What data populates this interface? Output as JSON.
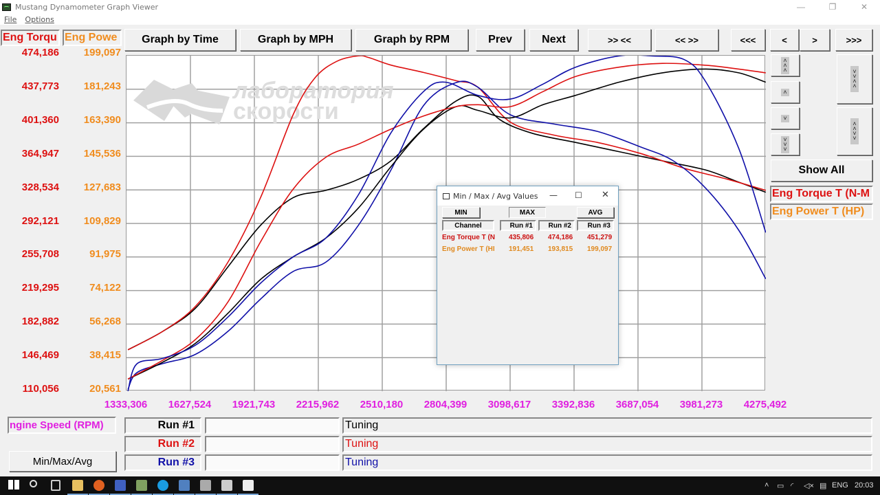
{
  "window": {
    "title": "Mustang Dynamometer Graph Viewer",
    "controls": {
      "minimize": "—",
      "maximize": "❐",
      "close": "✕"
    }
  },
  "menu": {
    "items": [
      {
        "label": "File",
        "accel": "F"
      },
      {
        "label": "Options",
        "accel": "O"
      }
    ]
  },
  "channels": {
    "left_torque_label": "Eng Torqu",
    "left_power_label": "Eng Powe",
    "right_torque_label": "Eng Torque T (N-M",
    "right_power_label": "Eng Power T (HP)",
    "x_channel_label": "ngine Speed (RPM)"
  },
  "toolbar": {
    "graph_by_time": "Graph by Time",
    "graph_by_mph": "Graph by MPH",
    "graph_by_rpm": "Graph by RPM",
    "prev": "Prev",
    "next": "Next",
    "zoom_in": ">> <<",
    "zoom_out": "<< >>",
    "first": "<<<",
    "left": "<",
    "right": ">",
    "last": ">>>"
  },
  "side_controls": {
    "scroll_up_fast": "˄˄˄",
    "scroll_up": "˄",
    "scroll_down": "˅",
    "scroll_down_fast": "˅˅˅",
    "expand": "˅˅˄˄",
    "compress": "˄˄˅˅",
    "show_all": "Show All"
  },
  "runs": [
    {
      "label": "Run #1",
      "name": "",
      "desc": "Tuning",
      "color": "#000000"
    },
    {
      "label": "Run #2",
      "name": "",
      "desc": "Tuning",
      "color": "#dd1111"
    },
    {
      "label": "Run #3",
      "name": "",
      "desc": "Tuning",
      "color": "#1010a8"
    }
  ],
  "minmax_button": "Min/Max/Avg",
  "watermark": {
    "line1": "лаборатория",
    "line2": "скорости"
  },
  "dialog": {
    "title": "Min / Max / Avg Values",
    "min_btn": "MIN",
    "max_btn": "MAX",
    "avg_btn": "AVG",
    "headers": [
      "Channel",
      "Run #1",
      "Run #2",
      "Run #3"
    ],
    "rows": [
      {
        "channel": "Eng Torque T (N",
        "values": [
          "435,806",
          "474,186",
          "451,279"
        ],
        "color": "#cc1111"
      },
      {
        "channel": "Eng Power T (HI",
        "values": [
          "191,451",
          "193,815",
          "199,097"
        ],
        "color": "#e08a20"
      }
    ]
  },
  "colors": {
    "torque": "#dd1111",
    "power": "#f08c1e",
    "rpm": "#e020e0"
  },
  "taskbar": {
    "language": "ENG",
    "time": "20:03",
    "apps": [
      "start",
      "search",
      "task-view",
      "file-explorer",
      "firefox",
      "save-app",
      "paint-app",
      "skype",
      "network-app",
      "dyno-viewer",
      "tuning-app",
      "photos"
    ]
  },
  "chart_data": {
    "type": "line",
    "title": "",
    "xlabel": "Engine Speed (RPM)",
    "ylabel_left": "Eng Torque T (N-M)",
    "ylabel_right": "Eng Power T (HP)",
    "xlim": [
      1333.306,
      4275.492
    ],
    "ylim_torque": [
      110.056,
      474.186
    ],
    "ylim_power": [
      20.561,
      199.097
    ],
    "x_ticks": [
      "1333,306",
      "1627,524",
      "1921,743",
      "2215,962",
      "2510,180",
      "2804,399",
      "3098,617",
      "3392,836",
      "3687,054",
      "3981,273",
      "4275,492"
    ],
    "y_ticks_torque": [
      "474,186",
      "437,773",
      "401,360",
      "364,947",
      "328,534",
      "292,121",
      "255,708",
      "219,295",
      "182,882",
      "146,469",
      "110,056"
    ],
    "y_ticks_power": [
      "199,097",
      "181,243",
      "163,390",
      "145,536",
      "127,683",
      "109,829",
      "91,975",
      "74,122",
      "56,268",
      "38,415",
      "20,561"
    ],
    "grid": true,
    "series": [
      {
        "name": "Run #1 Torque",
        "axis": "torque",
        "color": "#000000",
        "x": [
          1340,
          1500,
          1650,
          1800,
          1950,
          2100,
          2250,
          2400,
          2550,
          2700,
          2850,
          2950,
          3050,
          3200,
          3400,
          3600,
          3800,
          4000,
          4150,
          4275
        ],
        "y": [
          155,
          175,
          200,
          245,
          290,
          320,
          328,
          340,
          360,
          395,
          425,
          430,
          405,
          390,
          380,
          370,
          360,
          350,
          337,
          326
        ]
      },
      {
        "name": "Run #2 Torque",
        "axis": "torque",
        "color": "#dd1111",
        "x": [
          1340,
          1500,
          1650,
          1800,
          1950,
          2100,
          2200,
          2300,
          2400,
          2450,
          2550,
          2700,
          2850,
          2950,
          3100,
          3300,
          3500,
          3700,
          3900,
          4100,
          4275
        ],
        "y": [
          155,
          175,
          202,
          250,
          320,
          410,
          450,
          468,
          474,
          472,
          464,
          456,
          447,
          440,
          402,
          388,
          380,
          368,
          352,
          340,
          328
        ]
      },
      {
        "name": "Run #3 Torque",
        "axis": "torque",
        "color": "#1010a8",
        "x": [
          1340,
          1380,
          1500,
          1650,
          1800,
          1950,
          2100,
          2250,
          2400,
          2550,
          2700,
          2850,
          2950,
          3100,
          3300,
          3500,
          3700,
          3850,
          4000,
          4150,
          4275
        ],
        "y": [
          112,
          130,
          140,
          150,
          175,
          210,
          240,
          250,
          290,
          350,
          420,
          445,
          440,
          410,
          400,
          392,
          375,
          360,
          330,
          285,
          232
        ]
      },
      {
        "name": "Run #1 Power",
        "axis": "power",
        "color": "#000000",
        "x": [
          1340,
          1500,
          1650,
          1800,
          1950,
          2100,
          2250,
          2400,
          2550,
          2700,
          2850,
          2950,
          3100,
          3250,
          3400,
          3600,
          3800,
          4000,
          4150,
          4275
        ],
        "y": [
          27,
          36,
          46,
          62,
          80,
          92,
          102,
          118,
          140,
          160,
          172,
          170,
          166,
          173,
          178,
          185,
          190,
          192,
          190,
          185
        ]
      },
      {
        "name": "Run #2 Power",
        "axis": "power",
        "color": "#dd1111",
        "x": [
          1340,
          1500,
          1650,
          1800,
          1950,
          2100,
          2250,
          2400,
          2550,
          2700,
          2850,
          2950,
          3100,
          3250,
          3400,
          3600,
          3800,
          4000,
          4150,
          4275
        ],
        "y": [
          27,
          37,
          48,
          68,
          100,
          128,
          145,
          152,
          160,
          167,
          172,
          173,
          172,
          180,
          188,
          193,
          195,
          194,
          192,
          190
        ]
      },
      {
        "name": "Run #3 Power",
        "axis": "power",
        "color": "#1010a8",
        "x": [
          1340,
          1380,
          1500,
          1650,
          1800,
          1950,
          2100,
          2250,
          2400,
          2550,
          2700,
          2800,
          2950,
          3100,
          3250,
          3400,
          3600,
          3750,
          3900,
          4000,
          4150,
          4275
        ],
        "y": [
          20.6,
          35,
          38,
          45,
          60,
          78,
          92,
          102,
          125,
          158,
          180,
          185,
          178,
          176,
          184,
          193,
          199,
          199,
          197,
          185,
          150,
          105
        ]
      }
    ]
  }
}
